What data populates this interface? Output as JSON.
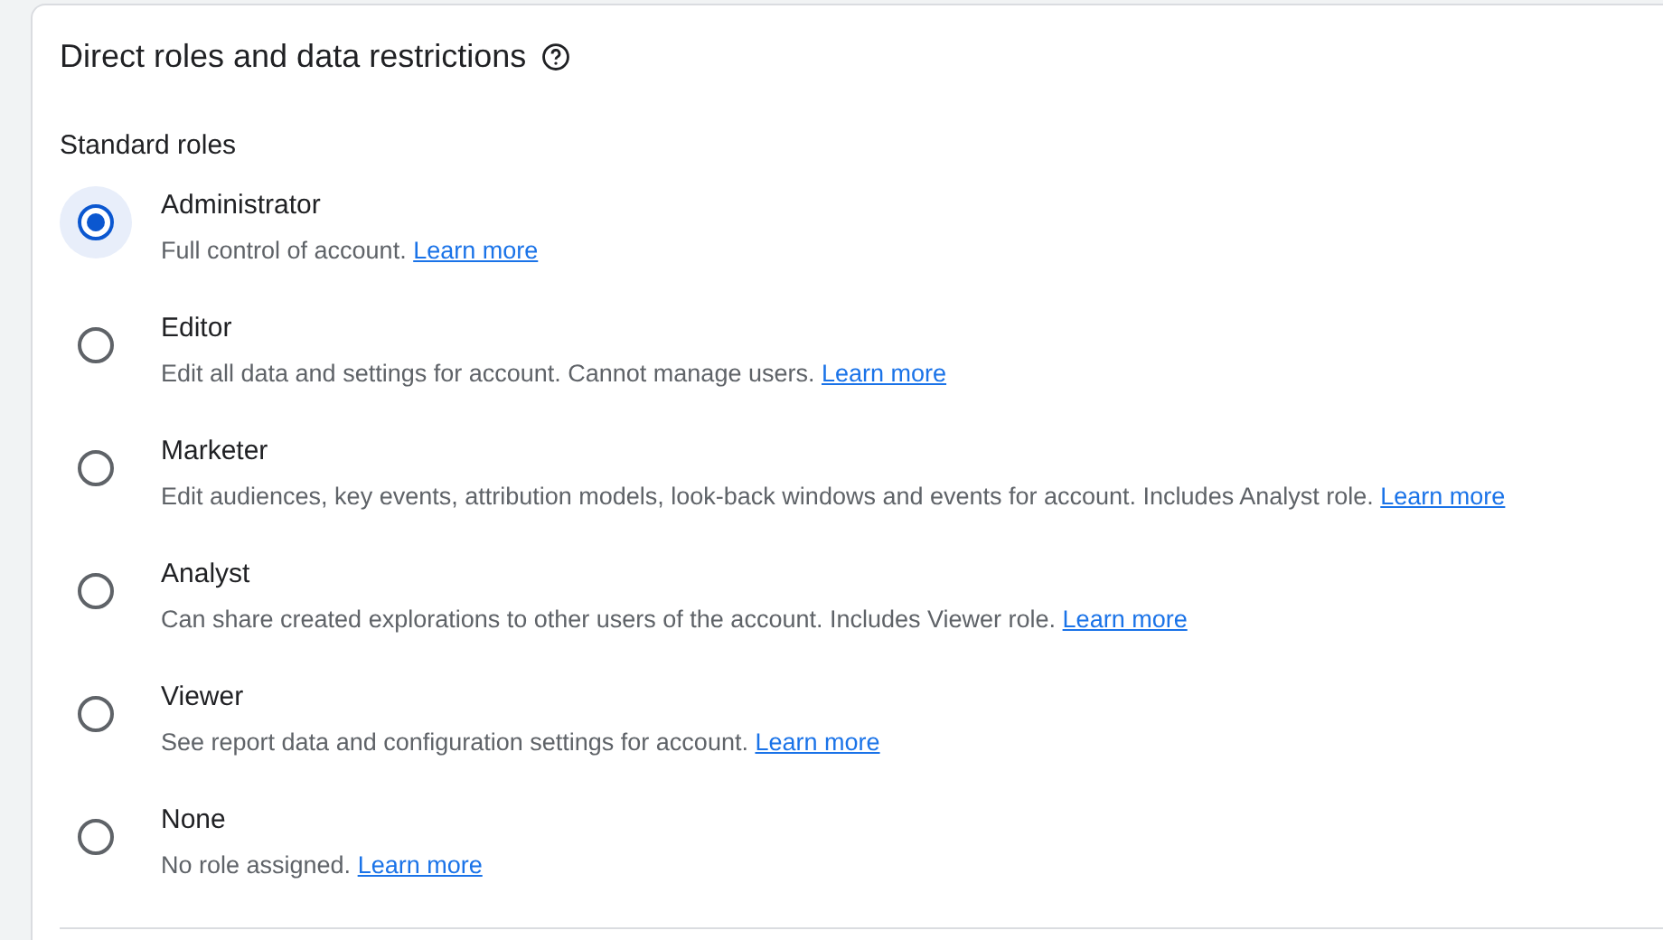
{
  "section": {
    "title": "Direct roles and data restrictions",
    "subtitle": "Standard roles"
  },
  "roles": [
    {
      "name": "Administrator",
      "description": "Full control of account.",
      "link": "Learn more",
      "selected": true
    },
    {
      "name": "Editor",
      "description": "Edit all data and settings for account. Cannot manage users.",
      "link": "Learn more",
      "selected": false
    },
    {
      "name": "Marketer",
      "description": "Edit audiences, key events, attribution models, look-back windows and events for account. Includes Analyst role.",
      "link": "Learn more",
      "selected": false
    },
    {
      "name": "Analyst",
      "description": "Can share created explorations to other users of the account. Includes Viewer role.",
      "link": "Learn more",
      "selected": false
    },
    {
      "name": "Viewer",
      "description": "See report data and configuration settings for account.",
      "link": "Learn more",
      "selected": false
    },
    {
      "name": "None",
      "description": "No role assigned.",
      "link": "Learn more",
      "selected": false
    }
  ]
}
